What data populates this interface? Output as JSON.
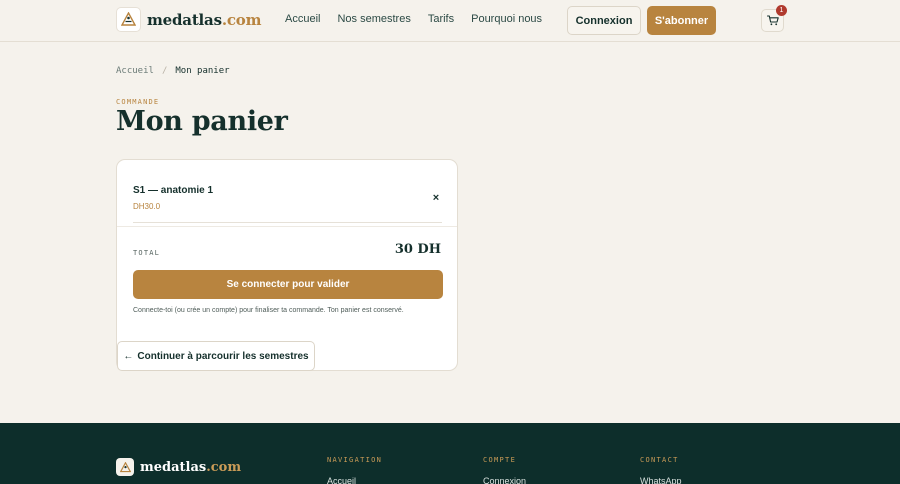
{
  "header": {
    "logo_name": "medatlas",
    "logo_tld": ".com",
    "nav": [
      "Accueil",
      "Nos semestres",
      "Tarifs",
      "Pourquoi nous"
    ],
    "login_label": "Connexion",
    "subscribe_label": "S'abonner",
    "cart_count": "1",
    "accent_color": "#b8843f"
  },
  "breadcrumb": {
    "home": "Accueil",
    "separator": "/",
    "current": "Mon panier"
  },
  "page": {
    "eyebrow": "COMMANDE",
    "title": "Mon panier"
  },
  "cart": {
    "items": [
      {
        "name": "S1 — anatomie 1",
        "price": "DH30.0",
        "remove_icon": "×"
      }
    ],
    "total_label": "TOTAL",
    "total_value": "30 DH",
    "cta_label": "Se connecter pour valider",
    "hint": "Connecte-toi (ou crée un compte) pour finaliser ta commande. Ton panier est conservé.",
    "continue_arrow": "←",
    "continue_label": "Continuer à parcourir les semestres"
  },
  "footer": {
    "logo_name": "medatlas",
    "logo_tld": ".com",
    "columns": [
      {
        "heading": "NAVIGATION",
        "first_link": "Accueil"
      },
      {
        "heading": "COMPTE",
        "first_link": "Connexion"
      },
      {
        "heading": "CONTACT",
        "first_link": "WhatsApp"
      }
    ],
    "background_color": "#0d2e2b"
  }
}
